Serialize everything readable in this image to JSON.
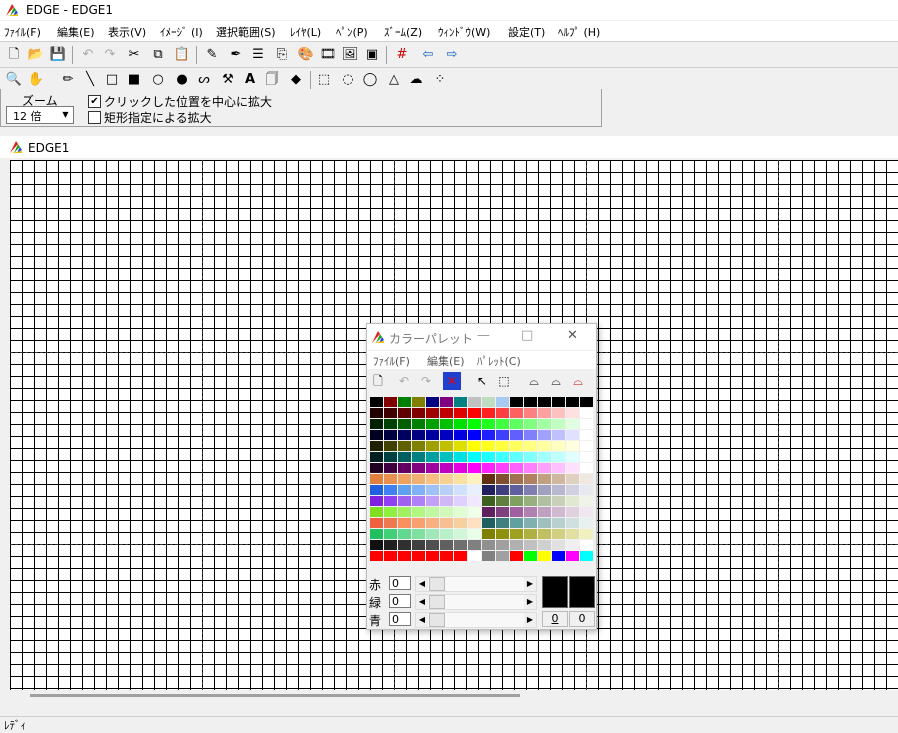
{
  "window": {
    "title": "EDGE - EDGE1"
  },
  "menu": [
    "ﾌｧｲﾙ(F)",
    "編集(E)",
    "表示(V)",
    "ｲﾒｰｼﾞ (I)",
    "選択範囲(S)",
    "ﾚｲﾔ(L)",
    "ﾍﾟﾝ(P)",
    "ｽﾞｰﾑ(Z)",
    "ｳｨﾝﾄﾞｳ(W)",
    "設定(T)",
    "ﾍﾙﾌﾟ (H)"
  ],
  "zoom": {
    "label": "ズーム",
    "value": "12 倍"
  },
  "options": {
    "click_center": {
      "label": "クリックした位置を中心に拡大",
      "checked": true
    },
    "rect_zoom": {
      "label": "矩形指定による拡大",
      "checked": false
    }
  },
  "document": {
    "title": "EDGE1"
  },
  "status": {
    "text": "ﾚﾃﾞｨ"
  },
  "palette": {
    "title": "カラーパレット",
    "menu": [
      "ﾌｧｲﾙ(F)",
      "編集(E)",
      "ﾊﾟﾚｯﾄ(C)"
    ],
    "minimize": "—",
    "maximize": "□",
    "close": "✕",
    "red_label": "赤",
    "green_label": "緑",
    "blue_label": "青",
    "red_value": "0",
    "green_value": "0",
    "blue_value": "0",
    "left_index": "0",
    "right_index": "0",
    "rows": [
      [
        "#000000",
        "#800000",
        "#008000",
        "#808000",
        "#000080",
        "#800080",
        "#008080",
        "#c0c0c0",
        "#c0dcc0",
        "#a6caf0",
        "#000000",
        "#000000",
        "#000000",
        "#000000",
        "#000000",
        "#000000"
      ],
      [
        "#200000",
        "#400000",
        "#600000",
        "#800000",
        "#a00000",
        "#c00000",
        "#e00000",
        "#ff0000",
        "#ff2020",
        "#ff4040",
        "#ff6060",
        "#ff8080",
        "#ffa0a0",
        "#ffc0c0",
        "#ffe0e0",
        "#ffffff"
      ],
      [
        "#002000",
        "#004000",
        "#006000",
        "#008000",
        "#00a000",
        "#00c000",
        "#00e000",
        "#00ff00",
        "#20ff20",
        "#40ff40",
        "#60ff60",
        "#80ff80",
        "#a0ffa0",
        "#c0ffc0",
        "#e0ffe0",
        "#ffffff"
      ],
      [
        "#000020",
        "#000040",
        "#000060",
        "#000080",
        "#0000a0",
        "#0000c0",
        "#0000e0",
        "#0000ff",
        "#2020ff",
        "#4040ff",
        "#6060ff",
        "#8080ff",
        "#a0a0ff",
        "#c0c0ff",
        "#e0e0ff",
        "#ffffff"
      ],
      [
        "#202000",
        "#404000",
        "#606000",
        "#808000",
        "#a0a000",
        "#c0c000",
        "#e0e000",
        "#ffff00",
        "#ffff20",
        "#ffff40",
        "#ffff60",
        "#ffff80",
        "#ffffa0",
        "#ffffc0",
        "#ffffe0",
        "#ffffff"
      ],
      [
        "#002020",
        "#004040",
        "#006060",
        "#008080",
        "#00a0a0",
        "#00c0c0",
        "#00e0e0",
        "#00ffff",
        "#20ffff",
        "#40ffff",
        "#60ffff",
        "#80ffff",
        "#a0ffff",
        "#c0ffff",
        "#e0ffff",
        "#ffffff"
      ],
      [
        "#200020",
        "#400040",
        "#600060",
        "#800080",
        "#a000a0",
        "#c000c0",
        "#e000e0",
        "#ff00ff",
        "#ff20ff",
        "#ff40ff",
        "#ff60ff",
        "#ff80ff",
        "#ffa0ff",
        "#ffc0ff",
        "#ffe0ff",
        "#ffffff"
      ],
      [
        "#e08040",
        "#e89050",
        "#f0a060",
        "#f0b070",
        "#f8c080",
        "#f8d090",
        "#f8e0a0",
        "#fff0c0",
        "#603010",
        "#805030",
        "#a07050",
        "#b08060",
        "#c0a080",
        "#d0b8a0",
        "#e0d0c0",
        "#f0e8e0"
      ],
      [
        "#2060e0",
        "#4080f0",
        "#60a0f0",
        "#80b0f8",
        "#a0c0f8",
        "#b8d0f8",
        "#d0e0ff",
        "#e8f0ff",
        "#202060",
        "#404080",
        "#6060a0",
        "#8080b0",
        "#a0a0c0",
        "#b8b8d0",
        "#d0d0e0",
        "#e8e8f0"
      ],
      [
        "#8020e0",
        "#9040f0",
        "#a060f0",
        "#b080f8",
        "#c0a0f8",
        "#d0b8f8",
        "#e0d0ff",
        "#f0e8ff",
        "#406020",
        "#608040",
        "#80a060",
        "#98b080",
        "#b0c0a0",
        "#c8d0b8",
        "#e0e8d0",
        "#f0f4e8"
      ],
      [
        "#80e020",
        "#90f040",
        "#a0f060",
        "#b0f880",
        "#c0f8a0",
        "#d0f8b8",
        "#e0ffd0",
        "#f0ffe8",
        "#602060",
        "#804080",
        "#a060a0",
        "#b080b0",
        "#c0a0c0",
        "#d0b8d0",
        "#e0d0e0",
        "#f0e8f0"
      ],
      [
        "#f06040",
        "#f07850",
        "#f89060",
        "#f8a070",
        "#f8b080",
        "#f8c090",
        "#f8d0a0",
        "#ffe0c0",
        "#206060",
        "#408080",
        "#60a0a0",
        "#80b0b0",
        "#a0c0c0",
        "#b8d0d0",
        "#d0e0e0",
        "#e8f0f0"
      ],
      [
        "#20c060",
        "#40d078",
        "#60d890",
        "#80e0a0",
        "#a0e8b8",
        "#b8f0c8",
        "#d0f8d8",
        "#e8ffe8",
        "#808000",
        "#909010",
        "#a0a020",
        "#b0b040",
        "#c0c060",
        "#d0d080",
        "#e0e0a0",
        "#f0f0c0"
      ],
      [
        "#101010",
        "#202020",
        "#303030",
        "#404040",
        "#505050",
        "#606060",
        "#707070",
        "#808080",
        "#909090",
        "#a0a0a0",
        "#b0b0b0",
        "#c0c0c0",
        "#d0d0d0",
        "#e0e0e0",
        "#f0f0f0",
        "#ffffff"
      ],
      [
        "#ff0000",
        "#ff0000",
        "#ff0000",
        "#ff0000",
        "#ff0000",
        "#ff0000",
        "#ff0000",
        "#ffffff",
        "#808080",
        "#a0a0a0",
        "#ff0000",
        "#00ff00",
        "#ffff00",
        "#0000ff",
        "#ff00ff",
        "#00ffff"
      ]
    ]
  }
}
